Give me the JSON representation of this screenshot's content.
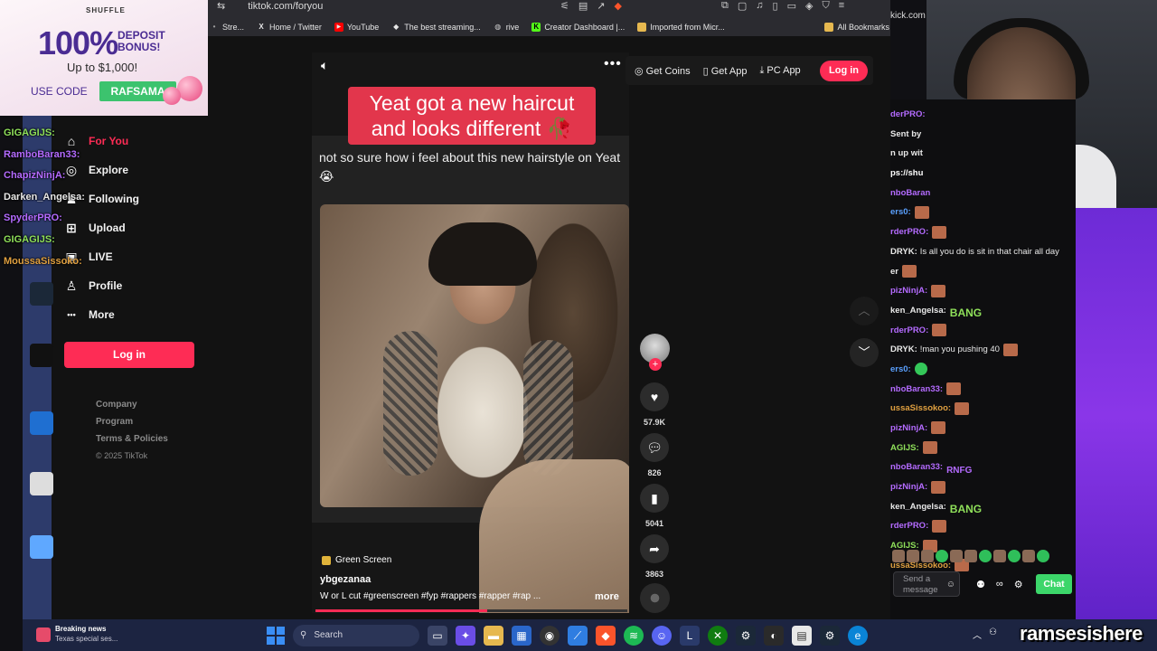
{
  "browser": {
    "url": "tiktok.com/foryou",
    "bookmarks": [
      {
        "label": "Stre...",
        "color": "#9b9b9b"
      },
      {
        "label": "Home / Twitter",
        "color": "#ffffff"
      },
      {
        "label": "YouTube",
        "color": "#ff0000"
      },
      {
        "label": "The best streaming...",
        "color": "#ffffff"
      },
      {
        "label": "rive",
        "color": "#cfcfcf"
      },
      {
        "label": "Creator Dashboard |...",
        "color": "#53fc18"
      },
      {
        "label": "Imported from Micr...",
        "color": "#e6b84f"
      }
    ],
    "all_bookmarks": "All Bookmarks"
  },
  "ad": {
    "brand": "SHUFFLE",
    "headline": "100%",
    "headline2": "DEPOSIT BONUS!",
    "upto": "Up to $1,000!",
    "use_code": "USE CODE",
    "code": "RAFSAMA"
  },
  "left_chat": [
    {
      "name": "GIGAGIJS:",
      "color": "#8fe05a"
    },
    {
      "name": "RamboBaran33:",
      "color": "#b46bff"
    },
    {
      "name": "ChapizNinjA:",
      "color": "#b46bff"
    },
    {
      "name": "Darken_Angelsa:",
      "color": "#e8e8e8"
    },
    {
      "name": "SpyderPRO:",
      "color": "#b46bff"
    },
    {
      "name": "GIGAGIJS:",
      "color": "#8fe05a"
    },
    {
      "name": "MoussaSissoko:",
      "color": "#e0a040"
    }
  ],
  "tiktok": {
    "nav": [
      {
        "label": "For You",
        "icon": "home-icon",
        "glyph": "⌂",
        "active": true
      },
      {
        "label": "Explore",
        "icon": "compass-icon",
        "glyph": "◎",
        "active": false
      },
      {
        "label": "Following",
        "icon": "following-icon",
        "glyph": "♟",
        "active": false
      },
      {
        "label": "Upload",
        "icon": "upload-icon",
        "glyph": "⊞",
        "active": false
      },
      {
        "label": "LIVE",
        "icon": "live-icon",
        "glyph": "▣",
        "active": false
      },
      {
        "label": "Profile",
        "icon": "profile-icon",
        "glyph": "♙",
        "active": false
      },
      {
        "label": "More",
        "icon": "more-icon",
        "glyph": "•••",
        "active": false
      }
    ],
    "login_label": "Log in",
    "footer": [
      "Company",
      "Program",
      "Terms & Policies"
    ],
    "copyright": "© 2025 TikTok",
    "top_actions": {
      "get_coins": "Get Coins",
      "get_app": "Get App",
      "pc_app": "PC App",
      "login": "Log in"
    },
    "video": {
      "caption": "Yeat got a new haircut and looks different 🥀",
      "subtitle": "not so sure how i feel about this new hairstyle on Yeat 😭",
      "effect": "Green Screen",
      "username": "ybgezanaa",
      "description": "W or L cut #greenscreen #fyp #rappers #rapper #rap ...",
      "more": "more",
      "progress": 0.55,
      "likes": "57.9K",
      "comments": "826",
      "saves": "5041",
      "shares": "3863"
    }
  },
  "kick_text": "kick.com",
  "chat": {
    "lines": [
      {
        "name": "derPRO:",
        "color": "#b46bff",
        "text": "",
        "emote": ""
      },
      {
        "name": "Sent by",
        "color": "#e8e8e8",
        "text": "",
        "emote": ""
      },
      {
        "name": "n up wit",
        "color": "#e8e8e8",
        "text": "",
        "emote": ""
      },
      {
        "name": "ps://shu",
        "color": "#ffffff",
        "text": "",
        "emote": ""
      },
      {
        "name": "nboBaran",
        "color": "#b46bff",
        "text": "",
        "emote": ""
      },
      {
        "name": "ers0:",
        "color": "#5aa0ff",
        "text": "",
        "emote": "e"
      },
      {
        "name": "rderPRO:",
        "color": "#b46bff",
        "text": "",
        "emote": "e"
      },
      {
        "name": "DRYK:",
        "color": "#e8e8e8",
        "text": "Is all you do is sit in that chair all day",
        "emote": ""
      },
      {
        "name": "er",
        "color": "#e8e8e8",
        "text": "",
        "emote": "e"
      },
      {
        "name": "pizNinjA:",
        "color": "#b46bff",
        "text": "",
        "emote": "e"
      },
      {
        "name": "ken_Angelsa:",
        "color": "#e8e8e8",
        "text": "",
        "emote": "BANG"
      },
      {
        "name": "rderPRO:",
        "color": "#b46bff",
        "text": "",
        "emote": "e"
      },
      {
        "name": "DRYK:",
        "color": "#e8e8e8",
        "text": "!man you pushing 40",
        "emote": "e"
      },
      {
        "name": "ers0:",
        "color": "#5aa0ff",
        "text": "",
        "emote": "g"
      },
      {
        "name": "nboBaran33:",
        "color": "#b46bff",
        "text": "",
        "emote": "e"
      },
      {
        "name": "ussaSissokoo:",
        "color": "#e0a040",
        "text": "",
        "emote": "e"
      },
      {
        "name": "pizNinjA:",
        "color": "#b46bff",
        "text": "",
        "emote": "e"
      },
      {
        "name": "AGIJS:",
        "color": "#8fe05a",
        "text": "",
        "emote": "e"
      },
      {
        "name": "nboBaran33:",
        "color": "#b46bff",
        "text": "",
        "emote": "RNFG"
      },
      {
        "name": "pizNinjA:",
        "color": "#b46bff",
        "text": "",
        "emote": "e"
      },
      {
        "name": "ken_Angelsa:",
        "color": "#e8e8e8",
        "text": "",
        "emote": "BANG"
      },
      {
        "name": "rderPRO:",
        "color": "#b46bff",
        "text": "",
        "emote": "e"
      },
      {
        "name": "AGIJS:",
        "color": "#8fe05a",
        "text": "",
        "emote": "e"
      },
      {
        "name": "ussaSissokoo:",
        "color": "#e0a040",
        "text": "",
        "emote": "e"
      }
    ],
    "input_placeholder": "Send a message",
    "chat_button": "Chat"
  },
  "taskbar": {
    "news_title": "Breaking news",
    "news_sub": "Texas special ses...",
    "search": "Search"
  },
  "streamer": "ramsesishere"
}
